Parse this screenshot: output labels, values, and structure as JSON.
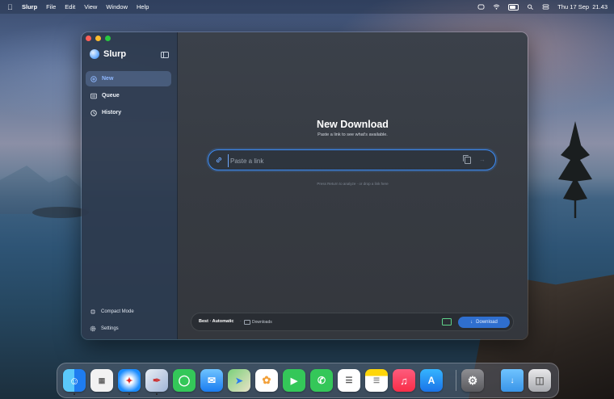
{
  "menubar": {
    "app_name": "Slurp",
    "items": [
      "File",
      "Edit",
      "View",
      "Window",
      "Help"
    ],
    "clock": "Thu 17 Sep  21.43"
  },
  "window": {
    "brand": "Slurp",
    "nav": [
      {
        "label": "New",
        "icon": "plus-circle-icon",
        "active": true
      },
      {
        "label": "Queue",
        "icon": "list-icon",
        "active": false
      },
      {
        "label": "History",
        "icon": "clock-icon",
        "active": false
      }
    ],
    "footer": {
      "compact_mode": "Compact Mode",
      "settings": "Settings"
    },
    "main": {
      "title": "New Download",
      "subtitle": "Paste a link to see what's available.",
      "input_placeholder": "Paste a link",
      "hint": "Press Return to analyze · or drop a link here",
      "bottom": {
        "format": "Best · Automatic",
        "separator": "·",
        "destination": "Downloads",
        "download_label": "Download"
      }
    }
  },
  "colors": {
    "accent": "#3c8cf7",
    "active_nav_text": "#8fb8ff",
    "download_button": "#2f6fcf"
  },
  "dock": [
    "finder-icon",
    "launchpad-icon",
    "safari-icon",
    "pencil-app-icon",
    "messages-icon",
    "mail-icon",
    "maps-icon",
    "photos-icon",
    "facetime-icon",
    "phone-icon",
    "reminders-icon",
    "notes-icon",
    "music-icon",
    "app-store-icon",
    "system-settings-icon",
    "downloads-folder-icon",
    "trash-icon"
  ]
}
